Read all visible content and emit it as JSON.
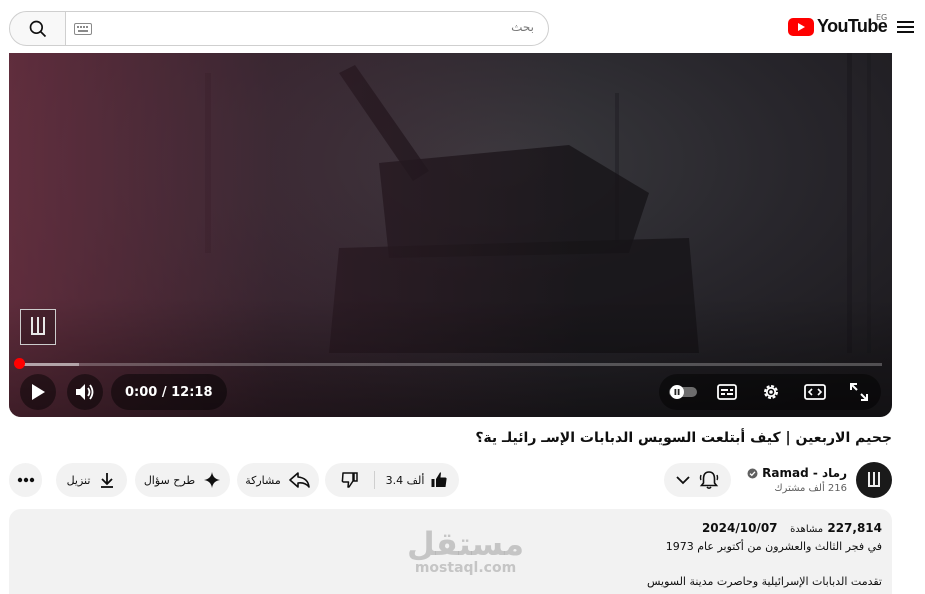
{
  "header": {
    "logo_text": "YouTube",
    "region_code": "EG",
    "search_placeholder": "بحث",
    "brand_color": "#ff0000"
  },
  "player": {
    "current_time": "0:00",
    "time_separator": "/",
    "duration": "12:18",
    "time_display": "0:00 / 12:18",
    "progress_fraction": 0.0,
    "buffered_fraction": 0.07,
    "progress_color": "#ff0000",
    "channel_watermark_icon": "ramad-logo-icon",
    "controls": [
      "play-icon",
      "volume-icon",
      "autoplay-toggle",
      "captions-icon",
      "settings-gear-icon",
      "theater-mode-icon",
      "fullscreen-icon"
    ]
  },
  "video": {
    "title": "جحيم الاربعين | كيف أبتلعت السويس الدبابات الإسـ رائيلـ ية؟"
  },
  "channel": {
    "name": "رماد - Ramad",
    "subscribers": "216 ألف مشترك",
    "verified_icon": "verified-check-icon"
  },
  "actions": {
    "like_count": "3.4 ألف",
    "share_label": "مشاركة",
    "ask_label": "طرح سؤال",
    "download_label": "تنزيل",
    "more_icon": "more-dots-icon",
    "subscribe_icon": "bell-icon"
  },
  "description": {
    "views": "227,814",
    "views_label": "مشاهدة",
    "date": "2024/10/07",
    "line_1": "في فجر الثالث والعشرون من أكتوبر عام 1973",
    "line_2": "تقدمت الدبابات الإسرائيلية وحاصرت مدينة السويس"
  },
  "overlay_watermark": {
    "arabic": "مستقل",
    "latin": "mostaql.com"
  }
}
